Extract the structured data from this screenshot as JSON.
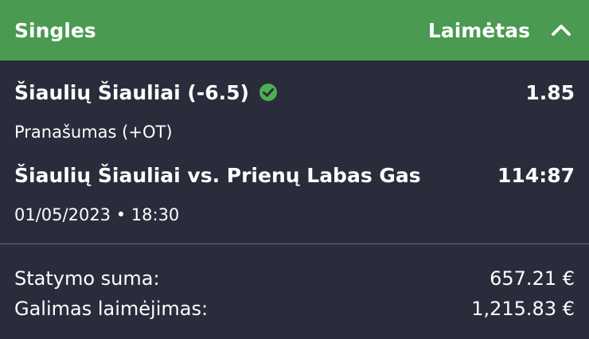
{
  "header": {
    "title": "Singles",
    "status": "Laimėtas",
    "collapse_icon": "chevron-up-icon"
  },
  "bet": {
    "selection": "Šiaulių Šiauliai (-6.5)",
    "won_icon": "check-circle-icon",
    "odds": "1.85",
    "market": "Pranašumas (+OT)",
    "event": "Šiaulių Šiauliai vs. Prienų Labas Gas",
    "score": "114:87",
    "datetime": "01/05/2023 • 18:30"
  },
  "summary": {
    "stake_label": "Statymo suma:",
    "stake_value": "657.21 €",
    "payout_label": "Galimas laimėjimas:",
    "payout_value": "1,215.83 €"
  },
  "colors": {
    "header_bg": "#4a9a52",
    "panel_bg": "#2b2c3b",
    "check_green": "#4caf50"
  }
}
